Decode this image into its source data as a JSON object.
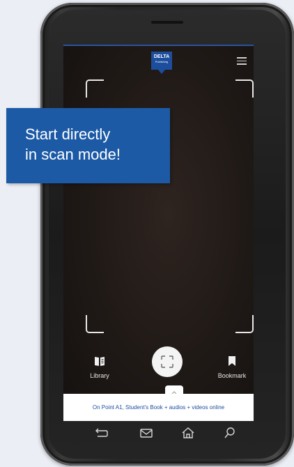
{
  "app": {
    "logo_text": "DELTA",
    "logo_subtext": "Publishing"
  },
  "badge": {
    "line1": "Start directly",
    "line2": "in scan mode!"
  },
  "toolbar": {
    "library_label": "Library",
    "bookmark_label": "Bookmark"
  },
  "info_bar": {
    "text": "On Point A1, Student's Book + audios + videos online"
  },
  "icons": {
    "menu": "menu-icon",
    "library": "book-icon",
    "scan": "scan-frame-icon",
    "bookmark": "bookmark-icon",
    "back": "back-icon",
    "mail": "mail-icon",
    "home": "home-icon",
    "search": "search-icon"
  },
  "colors": {
    "brand_blue": "#1c5aa6",
    "screen_dark": "#1f1916"
  }
}
